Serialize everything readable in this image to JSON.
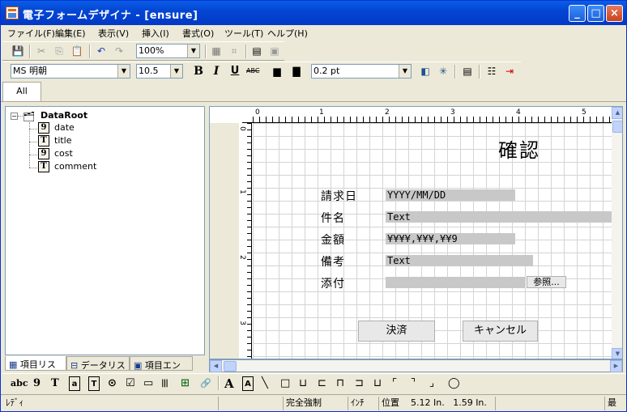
{
  "window": {
    "title": "電子フォームデザイナ - [ensure]",
    "controls": {
      "minimize": "_",
      "maximize": "□",
      "close": "×"
    }
  },
  "menu": [
    "ファイル(F)",
    "編集(E)",
    "表示(V)",
    "挿入(I)",
    "書式(O)",
    "ツール(T)",
    "ヘルプ(H)"
  ],
  "toolbar1": {
    "zoom": "100%"
  },
  "toolbar2": {
    "font": "MS 明朝",
    "size": "10.5",
    "bold": "B",
    "italic": "I",
    "underline": "U",
    "line_width": "0.2 pt"
  },
  "tab": {
    "all": "All"
  },
  "tree": {
    "root": "DataRoot",
    "items": [
      {
        "icon": "9",
        "label": "date"
      },
      {
        "icon": "T",
        "label": "title"
      },
      {
        "icon": "9",
        "label": "cost"
      },
      {
        "icon": "T",
        "label": "comment"
      }
    ]
  },
  "left_tabs": [
    "項目リスト",
    "データリスト",
    "項目エントリ"
  ],
  "ruler": {
    "top": [
      "0",
      "1",
      "2",
      "3",
      "4",
      "5"
    ],
    "left": [
      "0",
      "1",
      "2",
      "3"
    ]
  },
  "form": {
    "heading": "確認",
    "rows": [
      {
        "label": "請求日",
        "value": "YYYY/MM/DD"
      },
      {
        "label": "件名",
        "value": "Text"
      },
      {
        "label": "金額",
        "value": "¥¥¥¥,¥¥¥,¥¥9"
      },
      {
        "label": "備考",
        "value": "Text"
      },
      {
        "label": "添付",
        "value": ""
      }
    ],
    "browse_label": "参照...",
    "ok_label": "決済",
    "cancel_label": "キャンセル"
  },
  "bottom_tools": [
    "abc",
    "9",
    "T",
    "a",
    "T",
    "⊙",
    "☑",
    "▭",
    "|||",
    "⊞",
    "🔗",
    "A",
    "A",
    "╲",
    "□",
    "⊔",
    "⊏",
    "⊓",
    "⊐",
    "⊔",
    "⌜",
    "⌝",
    "⌟",
    "◯"
  ],
  "status": {
    "ready": "ﾚﾃﾞｨ",
    "mode": "完全強制",
    "unit": "ｲﾝﾁ",
    "position_label": "位置",
    "x": "5.12 In.",
    "y": "1.59 In.",
    "last": "最"
  }
}
